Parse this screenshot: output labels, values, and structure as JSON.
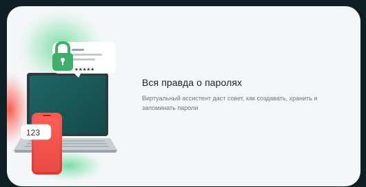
{
  "banner": {
    "title": "Вся правда о паролях",
    "description": "Виртуальный ассистент даст совет, как создавать, хранить и запоминать пароли",
    "illustration": {
      "phone_code": "123",
      "rating_stars": "★★★★★",
      "icons": [
        "lock-icon",
        "laptop-icon",
        "phone-icon",
        "password-card-icon"
      ]
    },
    "colors": {
      "background": "#0d1f23",
      "card": "#f4f7f8",
      "accent_green": "#3fae6b",
      "accent_red": "#e3463e",
      "laptop_screen": "#1b5b5a"
    }
  }
}
